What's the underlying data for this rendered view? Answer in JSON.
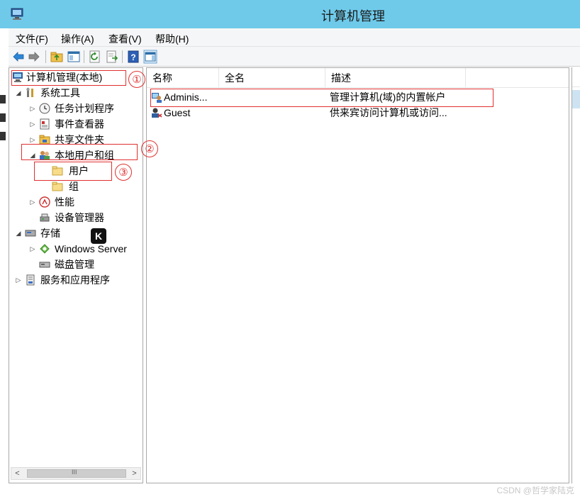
{
  "window": {
    "title": "计算机管理"
  },
  "menu": [
    "文件(F)",
    "操作(A)",
    "查看(V)",
    "帮助(H)"
  ],
  "toolbar": {
    "buttons": [
      "back-arrow-icon",
      "forward-arrow-icon",
      "up-folder-icon",
      "show-hide-tree-icon",
      "refresh-icon",
      "export-list-icon",
      "help-icon",
      "show-hide-action-pane-icon"
    ]
  },
  "tree": {
    "items": [
      {
        "label": "计算机管理(本地)",
        "icon": "computer-management-icon"
      },
      {
        "label": "系统工具",
        "icon": "tools-icon"
      },
      {
        "label": "任务计划程序",
        "icon": "clock-icon"
      },
      {
        "label": "事件查看器",
        "icon": "event-viewer-icon"
      },
      {
        "label": "共享文件夹",
        "icon": "shared-folder-icon"
      },
      {
        "label": "本地用户和组",
        "icon": "users-group-icon"
      },
      {
        "label": "用户",
        "icon": "folder-icon"
      },
      {
        "label": "组",
        "icon": "folder-icon"
      },
      {
        "label": "性能",
        "icon": "performance-icon"
      },
      {
        "label": "设备管理器",
        "icon": "device-manager-icon"
      },
      {
        "label": "存储",
        "icon": "storage-icon"
      },
      {
        "label": "Windows Server",
        "icon": "windows-server-backup-icon"
      },
      {
        "label": "磁盘管理",
        "icon": "disk-icon"
      },
      {
        "label": "服务和应用程序",
        "icon": "services-icon"
      }
    ],
    "scrollbar_grip": "III"
  },
  "list": {
    "columns": [
      "名称",
      "全名",
      "描述"
    ],
    "rows": [
      {
        "name": "Adminis...",
        "fullname": "",
        "description": "管理计算机(域)的内置帐户"
      },
      {
        "name": "Guest",
        "fullname": "",
        "description": "供来宾访问计算机或访问..."
      }
    ]
  },
  "annotations": {
    "markers": [
      "①",
      "②",
      "③"
    ],
    "color": "#e03030"
  },
  "badge": "K",
  "watermark": "CSDN @哲学家陆克",
  "colors": {
    "titlebar": "#6fcaea",
    "selection": "#cde3f2"
  }
}
